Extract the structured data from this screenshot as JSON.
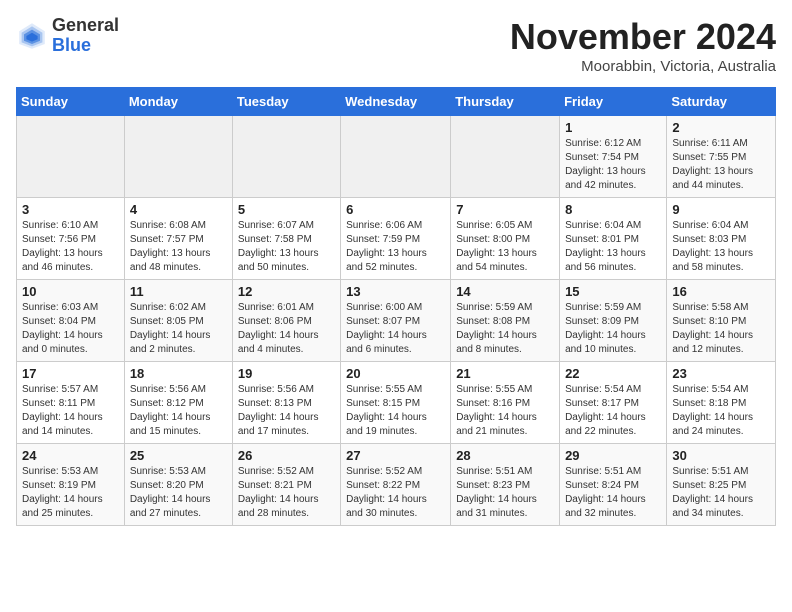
{
  "header": {
    "logo_general": "General",
    "logo_blue": "Blue",
    "month_title": "November 2024",
    "location": "Moorabbin, Victoria, Australia"
  },
  "weekdays": [
    "Sunday",
    "Monday",
    "Tuesday",
    "Wednesday",
    "Thursday",
    "Friday",
    "Saturday"
  ],
  "weeks": [
    [
      {
        "day": "",
        "detail": ""
      },
      {
        "day": "",
        "detail": ""
      },
      {
        "day": "",
        "detail": ""
      },
      {
        "day": "",
        "detail": ""
      },
      {
        "day": "",
        "detail": ""
      },
      {
        "day": "1",
        "detail": "Sunrise: 6:12 AM\nSunset: 7:54 PM\nDaylight: 13 hours\nand 42 minutes."
      },
      {
        "day": "2",
        "detail": "Sunrise: 6:11 AM\nSunset: 7:55 PM\nDaylight: 13 hours\nand 44 minutes."
      }
    ],
    [
      {
        "day": "3",
        "detail": "Sunrise: 6:10 AM\nSunset: 7:56 PM\nDaylight: 13 hours\nand 46 minutes."
      },
      {
        "day": "4",
        "detail": "Sunrise: 6:08 AM\nSunset: 7:57 PM\nDaylight: 13 hours\nand 48 minutes."
      },
      {
        "day": "5",
        "detail": "Sunrise: 6:07 AM\nSunset: 7:58 PM\nDaylight: 13 hours\nand 50 minutes."
      },
      {
        "day": "6",
        "detail": "Sunrise: 6:06 AM\nSunset: 7:59 PM\nDaylight: 13 hours\nand 52 minutes."
      },
      {
        "day": "7",
        "detail": "Sunrise: 6:05 AM\nSunset: 8:00 PM\nDaylight: 13 hours\nand 54 minutes."
      },
      {
        "day": "8",
        "detail": "Sunrise: 6:04 AM\nSunset: 8:01 PM\nDaylight: 13 hours\nand 56 minutes."
      },
      {
        "day": "9",
        "detail": "Sunrise: 6:04 AM\nSunset: 8:03 PM\nDaylight: 13 hours\nand 58 minutes."
      }
    ],
    [
      {
        "day": "10",
        "detail": "Sunrise: 6:03 AM\nSunset: 8:04 PM\nDaylight: 14 hours\nand 0 minutes."
      },
      {
        "day": "11",
        "detail": "Sunrise: 6:02 AM\nSunset: 8:05 PM\nDaylight: 14 hours\nand 2 minutes."
      },
      {
        "day": "12",
        "detail": "Sunrise: 6:01 AM\nSunset: 8:06 PM\nDaylight: 14 hours\nand 4 minutes."
      },
      {
        "day": "13",
        "detail": "Sunrise: 6:00 AM\nSunset: 8:07 PM\nDaylight: 14 hours\nand 6 minutes."
      },
      {
        "day": "14",
        "detail": "Sunrise: 5:59 AM\nSunset: 8:08 PM\nDaylight: 14 hours\nand 8 minutes."
      },
      {
        "day": "15",
        "detail": "Sunrise: 5:59 AM\nSunset: 8:09 PM\nDaylight: 14 hours\nand 10 minutes."
      },
      {
        "day": "16",
        "detail": "Sunrise: 5:58 AM\nSunset: 8:10 PM\nDaylight: 14 hours\nand 12 minutes."
      }
    ],
    [
      {
        "day": "17",
        "detail": "Sunrise: 5:57 AM\nSunset: 8:11 PM\nDaylight: 14 hours\nand 14 minutes."
      },
      {
        "day": "18",
        "detail": "Sunrise: 5:56 AM\nSunset: 8:12 PM\nDaylight: 14 hours\nand 15 minutes."
      },
      {
        "day": "19",
        "detail": "Sunrise: 5:56 AM\nSunset: 8:13 PM\nDaylight: 14 hours\nand 17 minutes."
      },
      {
        "day": "20",
        "detail": "Sunrise: 5:55 AM\nSunset: 8:15 PM\nDaylight: 14 hours\nand 19 minutes."
      },
      {
        "day": "21",
        "detail": "Sunrise: 5:55 AM\nSunset: 8:16 PM\nDaylight: 14 hours\nand 21 minutes."
      },
      {
        "day": "22",
        "detail": "Sunrise: 5:54 AM\nSunset: 8:17 PM\nDaylight: 14 hours\nand 22 minutes."
      },
      {
        "day": "23",
        "detail": "Sunrise: 5:54 AM\nSunset: 8:18 PM\nDaylight: 14 hours\nand 24 minutes."
      }
    ],
    [
      {
        "day": "24",
        "detail": "Sunrise: 5:53 AM\nSunset: 8:19 PM\nDaylight: 14 hours\nand 25 minutes."
      },
      {
        "day": "25",
        "detail": "Sunrise: 5:53 AM\nSunset: 8:20 PM\nDaylight: 14 hours\nand 27 minutes."
      },
      {
        "day": "26",
        "detail": "Sunrise: 5:52 AM\nSunset: 8:21 PM\nDaylight: 14 hours\nand 28 minutes."
      },
      {
        "day": "27",
        "detail": "Sunrise: 5:52 AM\nSunset: 8:22 PM\nDaylight: 14 hours\nand 30 minutes."
      },
      {
        "day": "28",
        "detail": "Sunrise: 5:51 AM\nSunset: 8:23 PM\nDaylight: 14 hours\nand 31 minutes."
      },
      {
        "day": "29",
        "detail": "Sunrise: 5:51 AM\nSunset: 8:24 PM\nDaylight: 14 hours\nand 32 minutes."
      },
      {
        "day": "30",
        "detail": "Sunrise: 5:51 AM\nSunset: 8:25 PM\nDaylight: 14 hours\nand 34 minutes."
      }
    ]
  ]
}
